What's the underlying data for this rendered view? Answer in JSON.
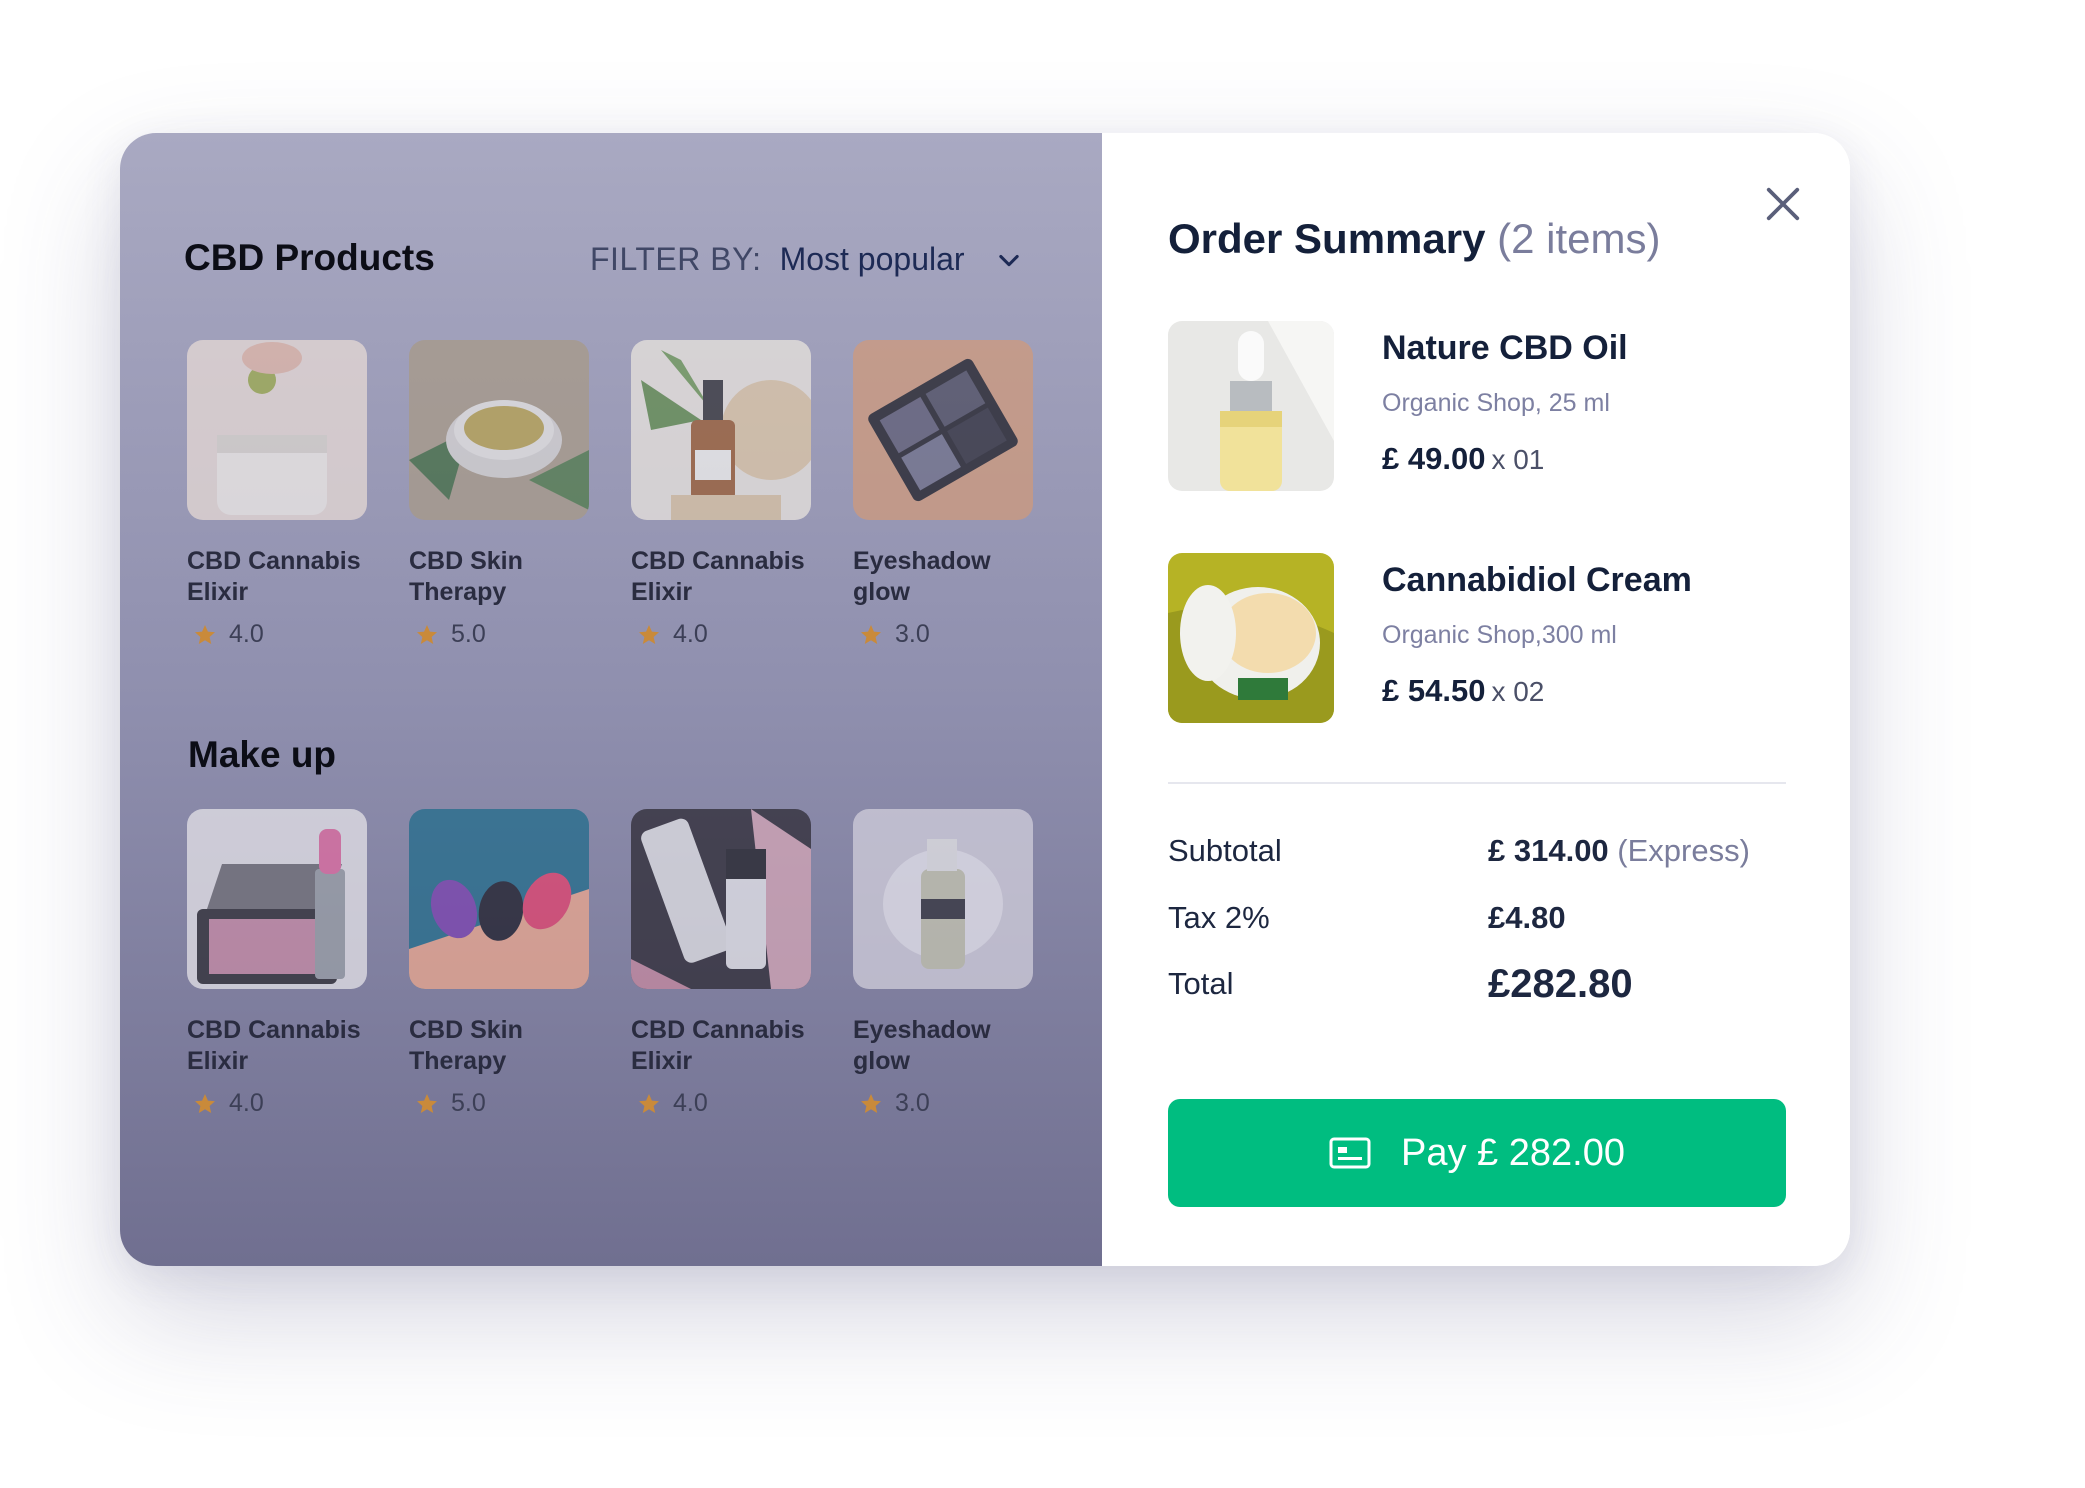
{
  "products_panel": {
    "cbd_title": "CBD Products",
    "filter_label": "FILTER BY:",
    "filter_value": "Most popular",
    "makeup_title": "Make up",
    "cbd_products": [
      {
        "name": "CBD Cannabis Elixir",
        "rating": "4.0",
        "image": "gummy-jar"
      },
      {
        "name": "CBD Skin Therapy",
        "rating": "5.0",
        "image": "balm-tin"
      },
      {
        "name": "CBD Cannabis Elixir",
        "rating": "4.0",
        "image": "dropper-bottle"
      },
      {
        "name": "Eyeshadow glow",
        "rating": "3.0",
        "image": "eyeshadow-palette"
      }
    ],
    "makeup_products": [
      {
        "name": "CBD Cannabis Elixir",
        "rating": "4.0",
        "image": "lipstick-compact"
      },
      {
        "name": "CBD Skin Therapy",
        "rating": "5.0",
        "image": "makeup-sponges"
      },
      {
        "name": "CBD Cannabis Elixir",
        "rating": "4.0",
        "image": "serum-tubes"
      },
      {
        "name": "Eyeshadow glow",
        "rating": "3.0",
        "image": "foam-bottle"
      }
    ]
  },
  "order_summary": {
    "title": "Order Summary",
    "count": "(2 items)",
    "items": [
      {
        "name": "Nature CBD Oil",
        "shop": "Organic Shop, 25 ml",
        "price": "£ 49.00",
        "qty": "x 01",
        "image": "oil-dropper"
      },
      {
        "name": "Cannabidiol Cream",
        "shop": "Organic Shop,300 ml",
        "price": "£ 54.50",
        "qty": "x 02",
        "image": "cbd-cream-jar"
      }
    ],
    "subtotal_label": "Subtotal",
    "subtotal_value": "£ 314.00",
    "subtotal_extra": "(Express)",
    "tax_label": "Tax 2%",
    "tax_value": "£4.80",
    "total_label": "Total",
    "total_value": "£282.80",
    "pay_label": "Pay £ 282.00"
  },
  "colors": {
    "accent": "#00bd80",
    "heading": "#14203a",
    "muted": "#7d80a2",
    "star": "#c98a3a"
  },
  "icons": [
    "close-icon",
    "chevron-down-icon",
    "star-icon",
    "credit-card-icon"
  ]
}
